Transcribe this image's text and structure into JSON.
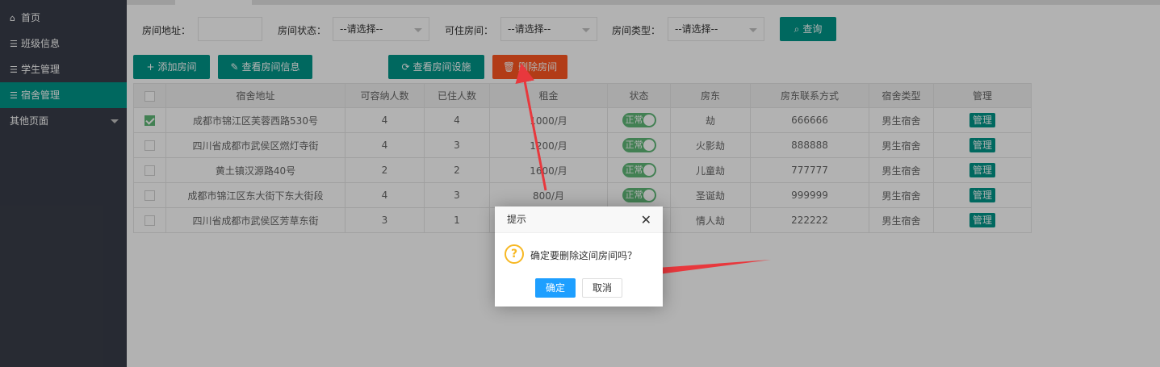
{
  "sidebar": {
    "items": [
      {
        "label": "首页",
        "icon": "home-icon"
      },
      {
        "label": "班级信息",
        "icon": "list-icon"
      },
      {
        "label": "学生管理",
        "icon": "list-icon"
      },
      {
        "label": "宿舍管理",
        "icon": "list-icon",
        "active": true
      },
      {
        "label": "其他页面",
        "icon": "caret-down-icon"
      }
    ]
  },
  "filters": {
    "address_label": "房间地址：",
    "address_value": "",
    "status_label": "房间状态：",
    "status_value": "--请选择--",
    "available_label": "可住房间：",
    "available_value": "--请选择--",
    "type_label": "房间类型：",
    "type_value": "--请选择--",
    "query_label": "查询"
  },
  "toolbar": {
    "add_label": "添加房间",
    "view_label": "查看房间信息",
    "facilities_label": "查看房间设施",
    "delete_label": "删除房间"
  },
  "table": {
    "headers": [
      "宿舍地址",
      "可容纳人数",
      "已住人数",
      "租金",
      "状态",
      "房东",
      "房东联系方式",
      "宿舍类型",
      "管理"
    ],
    "rows": [
      {
        "checked": true,
        "address": "成都市锦江区芙蓉西路530号",
        "capacity": "4",
        "occupied": "4",
        "rent": "1000/月",
        "status": "正常",
        "landlord": "劫",
        "phone": "666666",
        "type": "男生宿舍",
        "manage": "管理"
      },
      {
        "checked": false,
        "address": "四川省成都市武侯区燃灯寺街",
        "capacity": "4",
        "occupied": "3",
        "rent": "1200/月",
        "status": "正常",
        "landlord": "火影劫",
        "phone": "888888",
        "type": "男生宿舍",
        "manage": "管理"
      },
      {
        "checked": false,
        "address": "黄土镇汉源路40号",
        "capacity": "2",
        "occupied": "2",
        "rent": "1600/月",
        "status": "正常",
        "landlord": "儿童劫",
        "phone": "777777",
        "type": "男生宿舍",
        "manage": "管理"
      },
      {
        "checked": false,
        "address": "成都市锦江区东大街下东大街段",
        "capacity": "4",
        "occupied": "3",
        "rent": "800/月",
        "status": "正常",
        "landlord": "圣诞劫",
        "phone": "999999",
        "type": "男生宿舍",
        "manage": "管理"
      },
      {
        "checked": false,
        "address": "四川省成都市武侯区芳草东街",
        "capacity": "3",
        "occupied": "1",
        "rent": "",
        "status": "",
        "landlord": "情人劫",
        "phone": "222222",
        "type": "男生宿舍",
        "manage": "管理"
      }
    ]
  },
  "dialog": {
    "title": "提示",
    "message": "确定要删除这间房间吗？",
    "ok_label": "确定",
    "cancel_label": "取消"
  },
  "colors": {
    "accent": "#009688",
    "danger": "#ff5722",
    "sidebar_bg": "#393d49",
    "dialog_ok": "#1e9fff",
    "annotation_arrow": "#e8383d"
  }
}
